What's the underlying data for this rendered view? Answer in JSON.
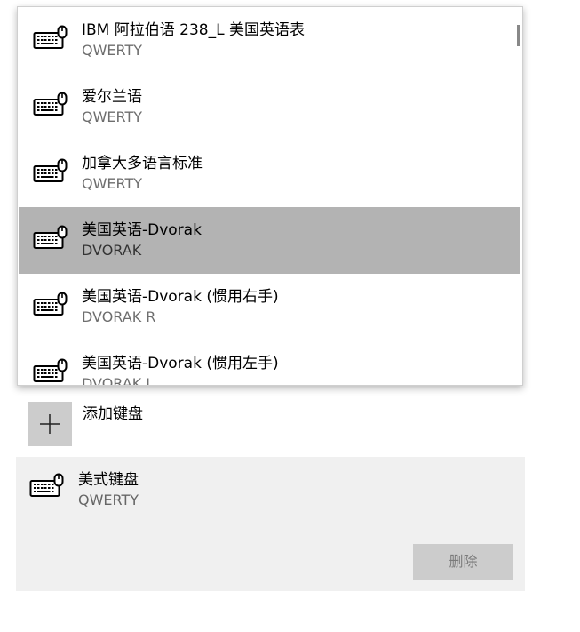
{
  "dropdown": {
    "options": [
      {
        "name": "IBM 阿拉伯语 238_L 美国英语表",
        "layout": "QWERTY",
        "selected": false
      },
      {
        "name": "爱尔兰语",
        "layout": "QWERTY",
        "selected": false
      },
      {
        "name": "加拿大多语言标准",
        "layout": "QWERTY",
        "selected": false
      },
      {
        "name": "美国英语-Dvorak",
        "layout": "DVORAK",
        "selected": true
      },
      {
        "name": "美国英语-Dvorak (惯用右手)",
        "layout": "DVORAK R",
        "selected": false
      },
      {
        "name": "美国英语-Dvorak (惯用左手)",
        "layout": "DVORAK L",
        "selected": false
      }
    ],
    "selected_color": "#b3b3b3"
  },
  "add_keyboard": {
    "label": "添加键盘",
    "icon": "plus-icon"
  },
  "installed_keyboard": {
    "name": "美式键盘",
    "layout": "QWERTY",
    "icon": "keyboard-icon",
    "remove_label": "删除"
  }
}
